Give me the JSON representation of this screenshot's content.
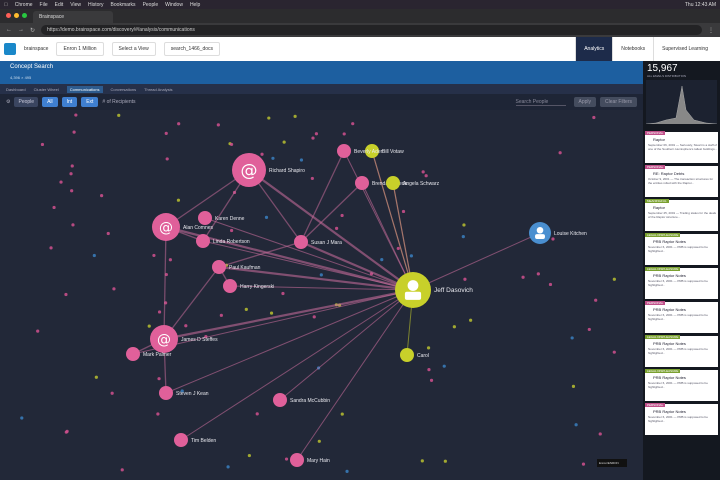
{
  "macbar": {
    "apple": "",
    "items": [
      "Chrome",
      "File",
      "Edit",
      "View",
      "History",
      "Bookmarks",
      "People",
      "Window",
      "Help"
    ],
    "clock": "Thu 12:43 AM"
  },
  "browser": {
    "tab_title": "Brainspace",
    "url": "https://demo.brainspace.com/discovery/#/analysis/communications"
  },
  "app": {
    "logo_text": "brainspace",
    "dataset": "Enron 1 Million",
    "select2": "Select a View",
    "select3": "search_1466_docs",
    "tabs": [
      {
        "label": "Analytics",
        "active": true
      },
      {
        "label": "Notebooks",
        "active": false
      },
      {
        "label": "Supervised Learning",
        "active": false
      }
    ]
  },
  "page": {
    "title": "Concept Search",
    "subtitle": "4,396 × 495"
  },
  "subtabs": [
    "Dashboard",
    "Cluster Wheel",
    "Communications",
    "Conversations",
    "Thread Analysis"
  ],
  "subtab_active": 2,
  "toolbar": {
    "people": "People",
    "a": "All",
    "b": "Int",
    "c": "Ext",
    "recipients": "# of Recipients",
    "search": "Search People",
    "apply": "Apply",
    "reset": "Clear Filters"
  },
  "panel": {
    "count": "15,967",
    "count_label": "ALL EMAILS DISTRIBUTION",
    "feed": [
      {
        "tag": "PERSONAL",
        "tag_color": "#c0508a",
        "title": "Raptor",
        "body": "September 06, 2001 — Seriously, Stuart is a staff of one of the Southern Hemisphere's tallest buildings..."
      },
      {
        "tag": "PERSONAL",
        "tag_color": "#c0508a",
        "title": "RE: Raptor Debts",
        "body": "October 9, 2001 — The transaction structures for the entities rolled with the Raptor..."
      },
      {
        "tag": "MEANINGFUL",
        "tag_color": "#7aa030",
        "title": "Raptor",
        "body": "September 25, 2001 — Trading status for the deals of the Raptor structure..."
      },
      {
        "tag": "LEGAL DISPLEASURE",
        "tag_color": "#7aa030",
        "title": "PRB Raptor Notes",
        "body": "November 6, 2001 — PRB is supposed to be highlighted..."
      },
      {
        "tag": "LEGAL DISPLEASURE",
        "tag_color": "#7aa030",
        "title": "PRB Raptor Notes",
        "body": "November 6, 2001 — PRB is supposed to be highlighted..."
      },
      {
        "tag": "PERSONAL",
        "tag_color": "#c0508a",
        "title": "PRB Raptor Notes",
        "body": "November 6, 2001 — PRB is supposed to be highlighted..."
      },
      {
        "tag": "LEGAL DISPLEASURE",
        "tag_color": "#7aa030",
        "title": "PRB Raptor Notes",
        "body": "November 6, 2001 — PRB is supposed to be highlighted..."
      },
      {
        "tag": "LEGAL DISPLEASURE",
        "tag_color": "#7aa030",
        "title": "PRB Raptor Notes",
        "body": "November 6, 2001 — PRB is supposed to be highlighted..."
      },
      {
        "tag": "PERSONAL",
        "tag_color": "#c0508a",
        "title": "PRB Raptor Notes",
        "body": "November 6, 2001 — PRB is supposed to be highlighted..."
      }
    ]
  },
  "graph": {
    "nodes": [
      {
        "label": "Jeff Dasovich",
        "type": "person",
        "color": "#c8d02a"
      },
      {
        "label": "Richard Shapiro",
        "type": "at",
        "color": "#e0609a"
      },
      {
        "label": "James D Steffes",
        "type": "at",
        "color": "#e0609a"
      },
      {
        "label": "Alan Comnes",
        "type": "at",
        "color": "#e0609a"
      },
      {
        "label": "Susan J Mara",
        "type": "node",
        "color": "#e0609a"
      },
      {
        "label": "Paul Kaufman",
        "type": "node",
        "color": "#e0609a"
      },
      {
        "label": "Linda Robertson",
        "type": "node",
        "color": "#e0609a"
      },
      {
        "label": "Karen Denne",
        "type": "node",
        "color": "#e0609a"
      },
      {
        "label": "Mark Palmer",
        "type": "node",
        "color": "#e0609a"
      },
      {
        "label": "Steven J Kean",
        "type": "node",
        "color": "#e0609a"
      },
      {
        "label": "Tim Belden",
        "type": "node",
        "color": "#e0609a"
      },
      {
        "label": "Mary Hain",
        "type": "node",
        "color": "#e0609a"
      },
      {
        "label": "Sandra McCubbin",
        "type": "node",
        "color": "#e0609a"
      },
      {
        "label": "Harry Kingerski",
        "type": "node",
        "color": "#e0609a"
      },
      {
        "label": "Bill Votaw",
        "type": "node",
        "color": "#c8d02a"
      },
      {
        "label": "Brenda Barreda",
        "type": "node",
        "color": "#e0609a"
      },
      {
        "label": "Angela Schwarz",
        "type": "node",
        "color": "#c8d02a"
      },
      {
        "label": "Beverly Aden",
        "type": "node",
        "color": "#e0609a"
      },
      {
        "label": "Carol",
        "type": "node",
        "color": "#c8d02a"
      },
      {
        "label": "Louise Kitchen",
        "type": "person",
        "color": "#4a8fd0"
      }
    ]
  }
}
